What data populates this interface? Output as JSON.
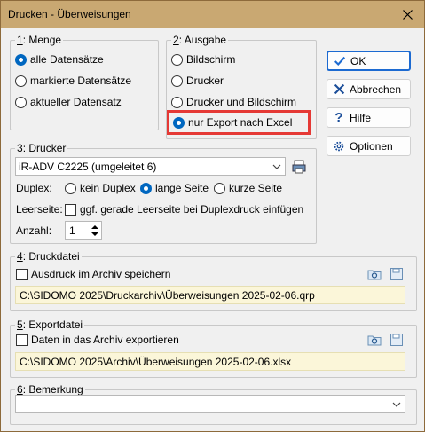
{
  "window": {
    "title": "Drucken - Überweisungen"
  },
  "menge": {
    "legend_prefix": "1",
    "legend_text": ": Menge",
    "options": [
      "alle Datensätze",
      "markierte Datensätze",
      "aktueller Datensatz"
    ],
    "selected_index": 0
  },
  "ausgabe": {
    "legend_prefix": "2",
    "legend_text": ": Ausgabe",
    "options": [
      "Bildschirm",
      "Drucker",
      "Drucker und Bildschirm",
      "nur Export nach Excel"
    ],
    "selected_index": 3
  },
  "buttons": {
    "ok": "OK",
    "cancel": "Abbrechen",
    "help": "Hilfe",
    "options": "Optionen"
  },
  "drucker": {
    "legend_prefix": "3",
    "legend_text": ": Drucker",
    "printer": "iR-ADV C2225 (umgeleitet 6)",
    "duplex_label": "Duplex:",
    "duplex_options": [
      "kein Duplex",
      "lange Seite",
      "kurze Seite"
    ],
    "duplex_selected": 1,
    "leerseite_label": "Leerseite:",
    "leerseite_text": "ggf. gerade Leerseite bei Duplexdruck einfügen",
    "anzahl_label": "Anzahl:",
    "anzahl_value": "1"
  },
  "druckdatei": {
    "legend_prefix": "4",
    "legend_text": ": Druckdatei",
    "checkbox": "Ausdruck im Archiv speichern",
    "path": "C:\\SIDOMO 2025\\Druckarchiv\\Überweisungen 2025-02-06.qrp"
  },
  "exportdatei": {
    "legend_prefix": "5",
    "legend_text": ": Exportdatei",
    "checkbox": "Daten in das Archiv exportieren",
    "path": "C:\\SIDOMO 2025\\Archiv\\Überweisungen 2025-02-06.xlsx"
  },
  "bemerkung": {
    "legend_prefix": "6",
    "legend_text": ": Bemerkung",
    "value": ""
  },
  "colors": {
    "titlebar": "#c9a872",
    "accent": "#0067c0",
    "highlight": "#e53935",
    "path_bg": "#fbf6d9"
  }
}
